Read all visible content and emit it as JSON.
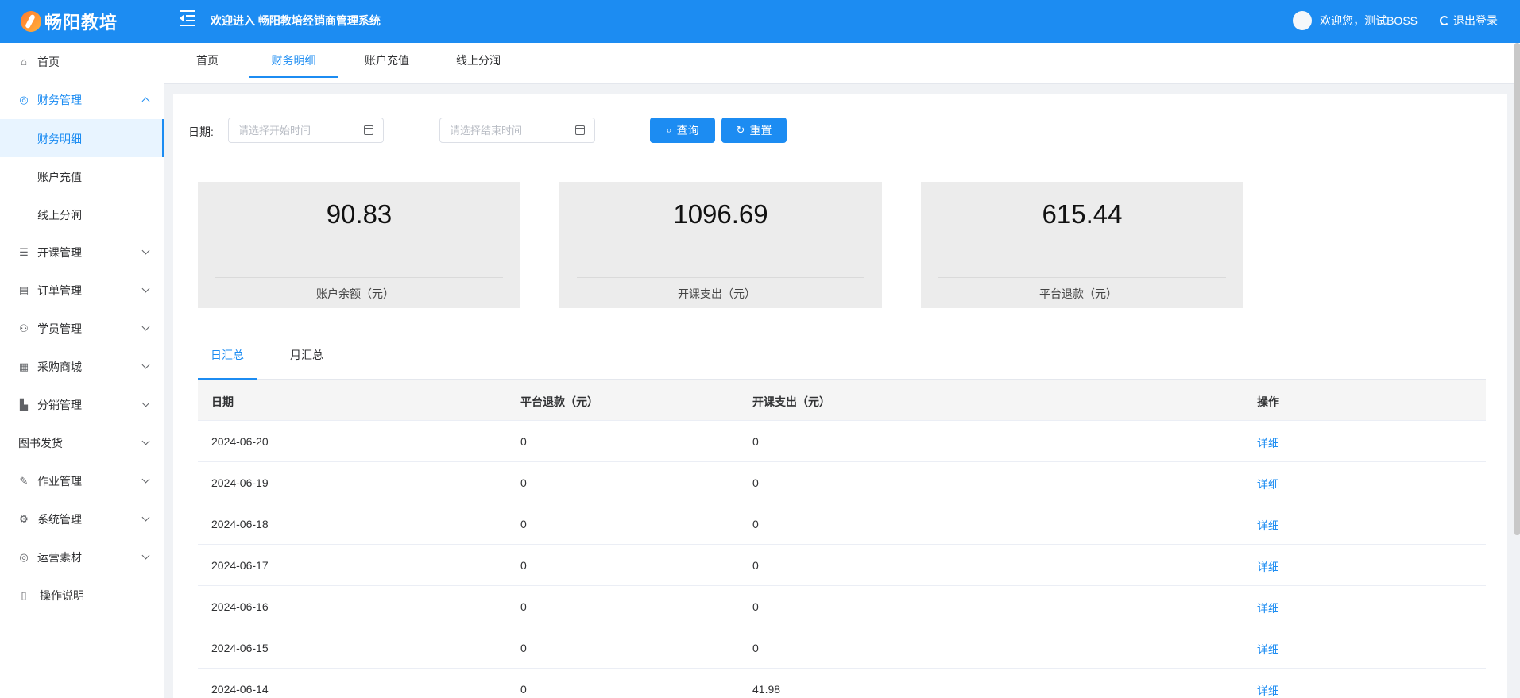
{
  "header": {
    "logo_text": "畅阳教培",
    "title": "欢迎进入 畅阳教培经销商管理系统",
    "greeting": "欢迎您，测试BOSS",
    "logout": "退出登录",
    "color": "#1c8cf2"
  },
  "sidebar": {
    "items": [
      {
        "label": "首页",
        "icon": "home-icon"
      },
      {
        "label": "财务管理",
        "icon": "finance-icon"
      },
      {
        "label": "财务明细"
      },
      {
        "label": "账户充值"
      },
      {
        "label": "线上分润"
      },
      {
        "label": "开课管理",
        "icon": "list-icon"
      },
      {
        "label": "订单管理",
        "icon": "order-icon"
      },
      {
        "label": "学员管理",
        "icon": "student-icon"
      },
      {
        "label": "采购商城",
        "icon": "shop-icon"
      },
      {
        "label": "分销管理",
        "icon": "chart-icon"
      },
      {
        "label": "图书发货"
      },
      {
        "label": "作业管理",
        "icon": "edit-icon"
      },
      {
        "label": "系统管理",
        "icon": "gear-icon"
      },
      {
        "label": "运营素材",
        "icon": "material-icon"
      },
      {
        "label": "操作说明",
        "icon": "doc-icon"
      }
    ]
  },
  "tabs": [
    "首页",
    "财务明细",
    "账户充值",
    "线上分润"
  ],
  "filter": {
    "label": "日期:",
    "start_placeholder": "请选择开始时间",
    "end_placeholder": "请选择结束时间",
    "search": "查询",
    "reset": "重置"
  },
  "stats": [
    {
      "value": "90.83",
      "label": "账户余额（元）"
    },
    {
      "value": "1096.69",
      "label": "开课支出（元）"
    },
    {
      "value": "615.44",
      "label": "平台退款（元）"
    }
  ],
  "summary_tabs": [
    "日汇总",
    "月汇总"
  ],
  "table": {
    "headers": [
      "日期",
      "平台退款（元）",
      "开课支出（元）",
      "操作"
    ],
    "rows": [
      [
        "2024-06-20",
        "0",
        "0",
        "详细"
      ],
      [
        "2024-06-19",
        "0",
        "0",
        "详细"
      ],
      [
        "2024-06-18",
        "0",
        "0",
        "详细"
      ],
      [
        "2024-06-17",
        "0",
        "0",
        "详细"
      ],
      [
        "2024-06-16",
        "0",
        "0",
        "详细"
      ],
      [
        "2024-06-15",
        "0",
        "0",
        "详细"
      ],
      [
        "2024-06-14",
        "0",
        "41.98",
        "详细"
      ]
    ]
  }
}
